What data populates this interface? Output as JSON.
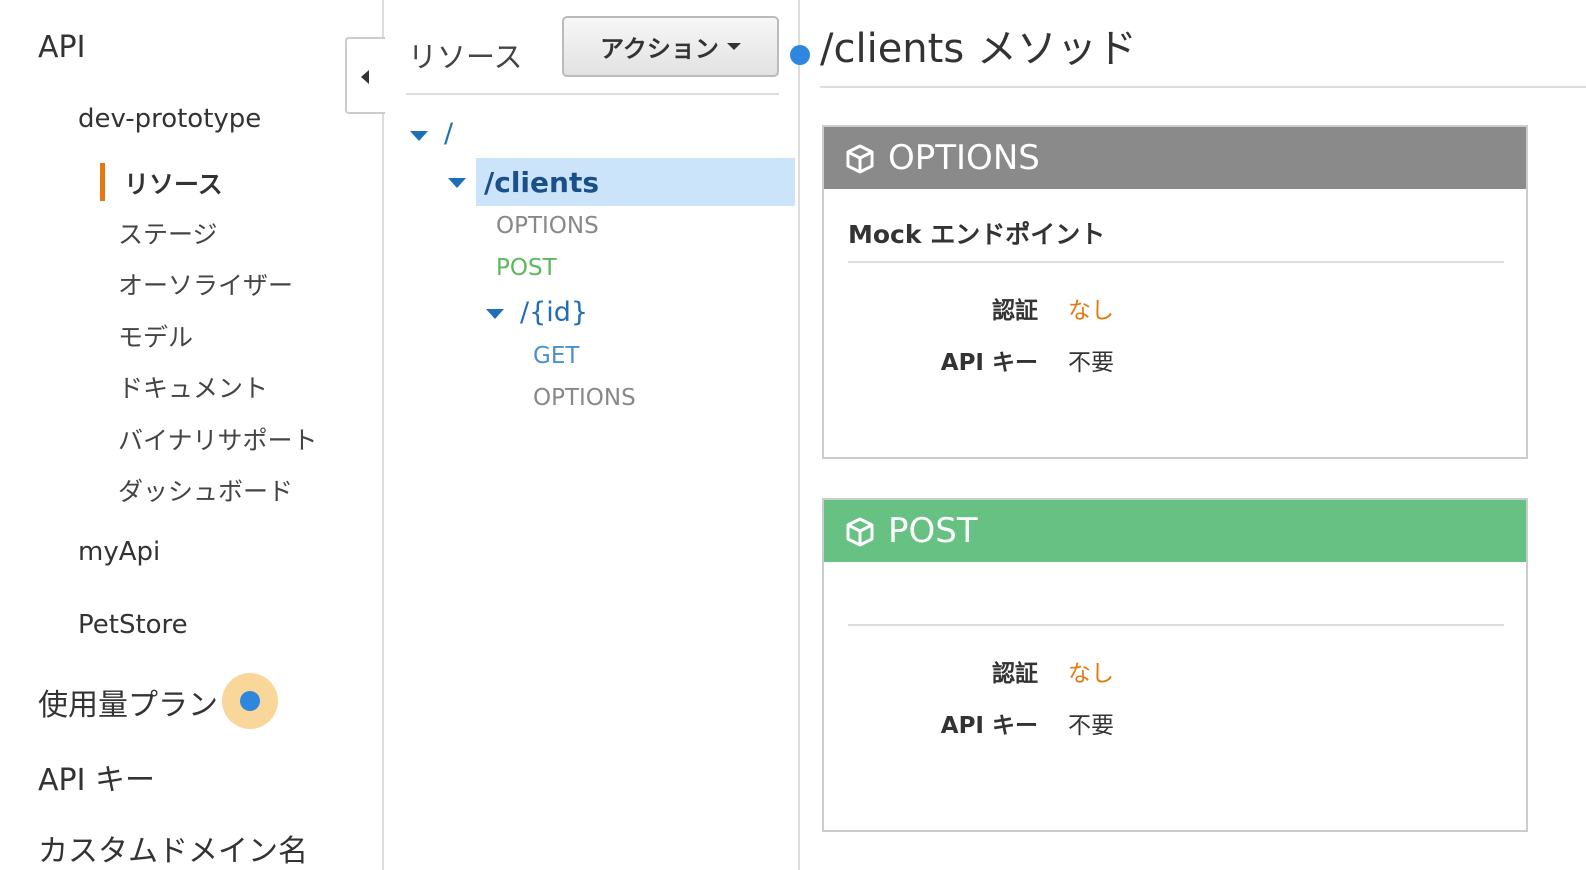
{
  "left_nav": {
    "api_header": "API",
    "apis": [
      {
        "name": "dev-prototype",
        "sub_items": [
          "リソース",
          "ステージ",
          "オーソライザー",
          "モデル",
          "ドキュメント",
          "バイナリサポート",
          "ダッシュボード"
        ],
        "active": "リソース"
      },
      {
        "name": "myApi"
      },
      {
        "name": "PetStore"
      }
    ],
    "usage_plans": "使用量プラン",
    "api_keys": "API キー",
    "custom_domains": "カスタムドメイン名"
  },
  "tree": {
    "title": "リソース",
    "actions_label": "アクション",
    "root": "/",
    "clients": {
      "path": "/clients",
      "methods": [
        "OPTIONS",
        "POST"
      ]
    },
    "id": {
      "path": "/{id}",
      "methods": [
        "GET",
        "OPTIONS"
      ]
    }
  },
  "content": {
    "title": "/clients メソッド",
    "cards": [
      {
        "method": "OPTIONS",
        "color": "#8a8a8a",
        "subtitle": "Mock エンドポイント",
        "auth_label": "認証",
        "auth_value": "なし",
        "apikey_label": "API キー",
        "apikey_value": "不要"
      },
      {
        "method": "POST",
        "color": "#66c183",
        "subtitle": "",
        "auth_label": "認証",
        "auth_value": "なし",
        "apikey_label": "API キー",
        "apikey_value": "不要"
      }
    ]
  },
  "colors": {
    "accent": "#e47911",
    "link": "#1f6fb7",
    "selected_bg": "#cce4fa"
  },
  "icons": {
    "collapse": "chevron-left-icon",
    "toggle": "triangle-down-icon",
    "method": "cube-icon"
  }
}
